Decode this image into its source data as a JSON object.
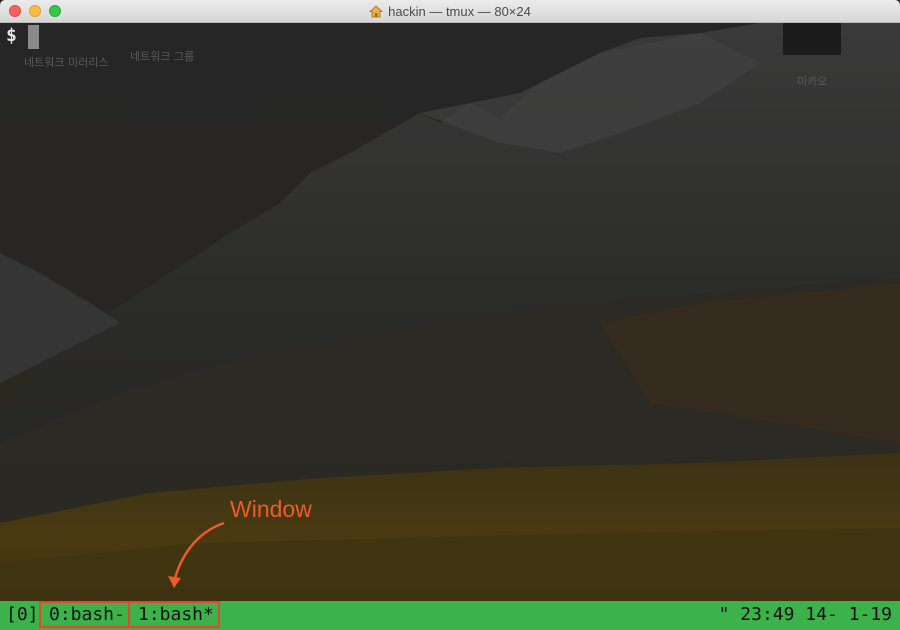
{
  "window": {
    "title": "hackin — tmux — 80×24"
  },
  "desktop": {
    "icon_labels": [
      "네트워크 미러리스",
      "네트워크 그룹",
      "미카오"
    ]
  },
  "terminal": {
    "prompt": "$"
  },
  "annotation": {
    "label": "Window",
    "color": "#f05a28"
  },
  "statusbar": {
    "session": "[0]",
    "windows": [
      "0:bash-",
      "1:bash*"
    ],
    "right_status": "\" 23:49 14- 1-19",
    "color": "#3bb34a"
  }
}
